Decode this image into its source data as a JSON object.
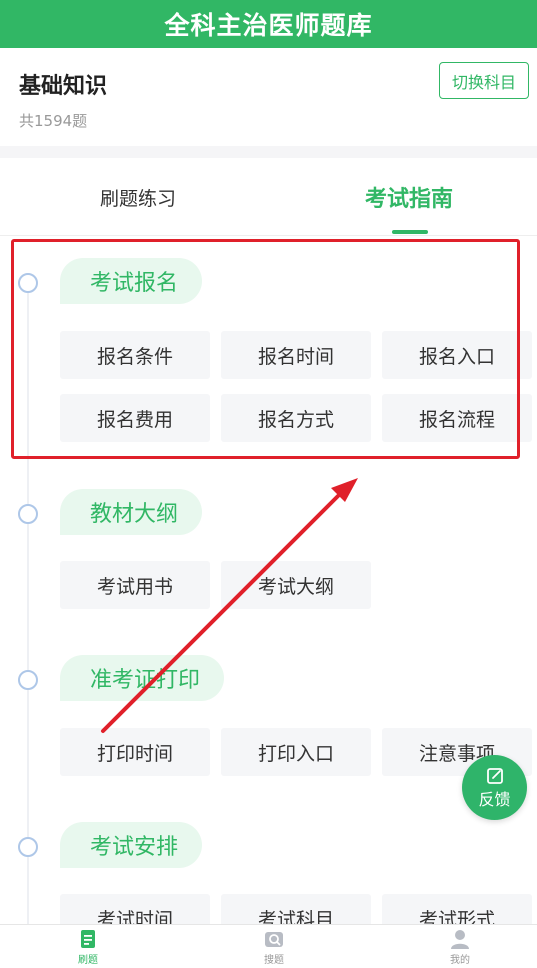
{
  "header": {
    "title": "全科主治医师题库"
  },
  "subject": {
    "name": "基础知识",
    "count": "共1594题",
    "switch_label": "切换科目"
  },
  "tabs": [
    {
      "label": "刷题练习",
      "active": false
    },
    {
      "label": "考试指南",
      "active": true
    }
  ],
  "sections": [
    {
      "title": "考试报名",
      "items": [
        "报名条件",
        "报名时间",
        "报名入口",
        "报名费用",
        "报名方式",
        "报名流程"
      ]
    },
    {
      "title": "教材大纲",
      "items": [
        "考试用书",
        "考试大纲"
      ]
    },
    {
      "title": "准考证打印",
      "items": [
        "打印时间",
        "打印入口",
        "注意事项"
      ]
    },
    {
      "title": "考试安排",
      "items": [
        "考试时间",
        "考试科目",
        "考试形式"
      ]
    }
  ],
  "feedback": {
    "label": "反馈"
  },
  "bottom_nav": [
    {
      "label": "刷题",
      "icon": "document-icon",
      "active": true
    },
    {
      "label": "搜题",
      "icon": "camera-search-icon",
      "active": false
    },
    {
      "label": "我的",
      "icon": "user-icon",
      "active": false
    }
  ],
  "colors": {
    "primary": "#31b765",
    "annotation_red": "#e0202a",
    "chip_bg": "#f5f6f8",
    "section_bg": "#e8f8ee"
  }
}
